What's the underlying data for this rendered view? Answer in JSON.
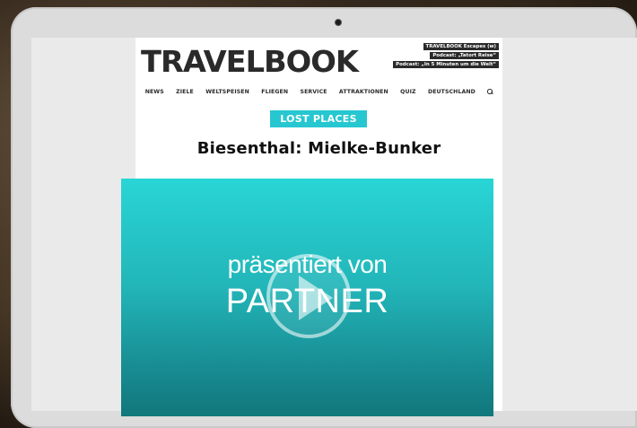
{
  "site": {
    "logo": "TRAVELBOOK",
    "podcasts": [
      "TRAVELBOOK Escapes (w)",
      "Podcast: „Tatort Reise“",
      "Podcast: „In 5 Minuten um die Welt“"
    ]
  },
  "nav": {
    "items": [
      "NEWS",
      "ZIELE",
      "WELTSPEISEN",
      "FLIEGEN",
      "SERVICE",
      "ATTRAKTIONEN",
      "QUIZ",
      "DEUTSCHLAND"
    ],
    "search_icon": "search-icon"
  },
  "article": {
    "category": "LOST PLACES",
    "headline": "Biesenthal: Mielke-Bunker"
  },
  "video": {
    "presented_by": "präsentiert von",
    "partner": "PARTNER",
    "play_icon": "play-icon"
  },
  "colors": {
    "accent": "#26c7d1",
    "video_top": "#29d5d6",
    "video_bottom": "#11777c"
  }
}
